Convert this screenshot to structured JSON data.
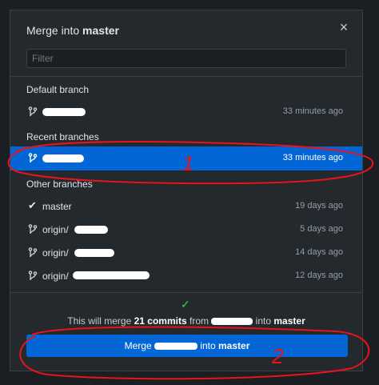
{
  "dialog": {
    "title_prefix": "Merge into",
    "title_branch": "master",
    "close_glyph": "×",
    "filter_placeholder": "Filter"
  },
  "sections": {
    "default_label": "Default branch",
    "recent_label": "Recent branches",
    "other_label": "Other branches"
  },
  "default_branch": {
    "name": "",
    "time": "33 minutes ago"
  },
  "recent_branch": {
    "name": "",
    "time": "33 minutes ago",
    "annotation": "1"
  },
  "other_branches": [
    {
      "name": "master",
      "time": "19 days ago",
      "icon": "check-icon"
    },
    {
      "name": "origin/",
      "time": "5 days ago",
      "icon": "branch-icon"
    },
    {
      "name": "origin/",
      "time": "14 days ago",
      "icon": "branch-icon"
    },
    {
      "name": "origin/",
      "time": "12 days ago",
      "icon": "branch-icon"
    }
  ],
  "footer": {
    "summary_prefix": "This will merge",
    "commits": "21 commits",
    "from": "from",
    "into": "into",
    "target": "master",
    "button_prefix": "Merge",
    "button_into": "into",
    "button_target": "master",
    "annotation": "2"
  },
  "colors": {
    "accent": "#0366d6",
    "annotation": "#e8131c",
    "success": "#34d058"
  }
}
